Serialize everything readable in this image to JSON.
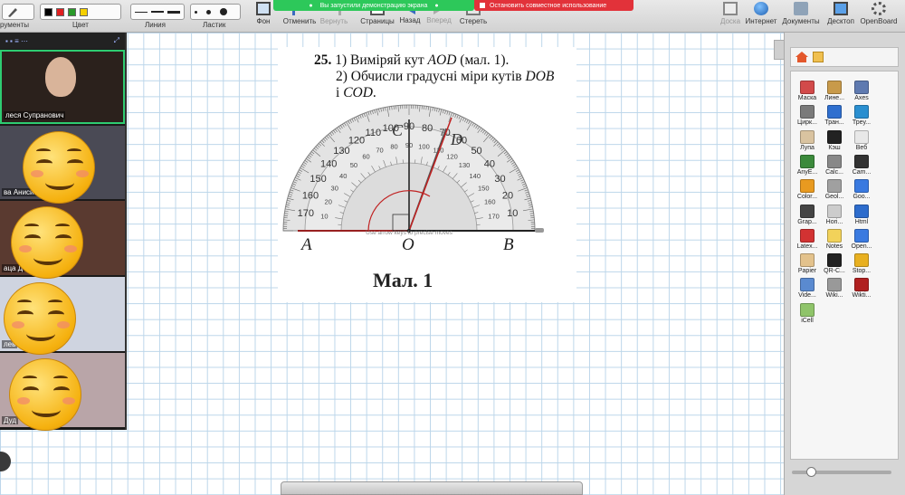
{
  "toolbar": {
    "tools_label": "рументы",
    "color_label": "Цвет",
    "line_label": "Линия",
    "eraser_label": "Ластик",
    "bg_label": "Фон",
    "undo_label": "Отменить",
    "redo_label": "Вернуть",
    "pages_label": "Страницы",
    "back_label": "Назад",
    "forward_label": "Вперед",
    "erase_label": "Стереть",
    "board_label": "Доска",
    "internet_label": "Интернет",
    "documents_label": "Документы",
    "desktop_label": "Десктоп",
    "app_label": "OpenBoard",
    "colors": [
      "#000000",
      "#e02020",
      "#2a9a2a",
      "#f5d000"
    ]
  },
  "share": {
    "banner_text": "Вы запустили демонстрацию экрана",
    "stop_text": "Остановить совместное использование"
  },
  "participants": [
    {
      "name": "леся Супранович",
      "emoji": false
    },
    {
      "name": "ва Анисимо",
      "emoji": true
    },
    {
      "name": "аца Д",
      "emoji": true
    },
    {
      "name": "лев",
      "emoji": true
    },
    {
      "name": "Дуд",
      "emoji": true
    }
  ],
  "document": {
    "task_number": "25.",
    "line1_pre": "1) Виміряй кут ",
    "line1_italic": "AOD",
    "line1_post": " (мал. 1).",
    "line2_pre": "2) Обчисли градусні міри кутів ",
    "line2_italic": "DOB",
    "line3_pre": "і ",
    "line3_italic": "COD",
    "line3_post": ".",
    "caption": "Мал. 1",
    "hint": "Use arrow keys to precise moves",
    "label_a": "A",
    "label_o": "O",
    "label_b": "B",
    "label_c": "C",
    "label_d": "D",
    "outer_scale": [
      "170",
      "160",
      "150",
      "140",
      "130",
      "120",
      "110",
      "100",
      "90",
      "80",
      "70",
      "60",
      "50",
      "40",
      "30",
      "20",
      "10"
    ],
    "inner_scale": [
      "10",
      "20",
      "30",
      "40",
      "50",
      "60",
      "70",
      "80",
      "90",
      "100",
      "110",
      "120",
      "130",
      "140",
      "150",
      "160",
      "170"
    ]
  },
  "apps": [
    "Маска",
    "Лине...",
    "Axes",
    "Цирк...",
    "Тран...",
    "Треу...",
    "Лупа",
    "Кэш",
    "Веб",
    "AnyE...",
    "Calc...",
    "Cam...",
    "Color...",
    "Geol...",
    "Goo...",
    "Grap...",
    "Hori...",
    "Html",
    "Latex...",
    "Notes",
    "Open...",
    "Papier",
    "QR-C...",
    "Stop...",
    "Vide...",
    "Wiki...",
    "Wikti...",
    "iCell"
  ],
  "app_colors": [
    "#d24a4a",
    "#c89a4a",
    "#5f7ab0",
    "#7a7a7a",
    "#2f6fcf",
    "#2a8fd0",
    "#d9c3a0",
    "#222222",
    "#e8e8e8",
    "#3b8a3b",
    "#888888",
    "#333333",
    "#e89a20",
    "#a0a0a0",
    "#3a7ae0",
    "#444444",
    "#cccccc",
    "#2d6ccc",
    "#d23232",
    "#f2d25a",
    "#3a7ae0",
    "#e3c28c",
    "#222222",
    "#e8b020",
    "#5a8ad0",
    "#999999",
    "#b02020",
    "#8fc46a"
  ]
}
